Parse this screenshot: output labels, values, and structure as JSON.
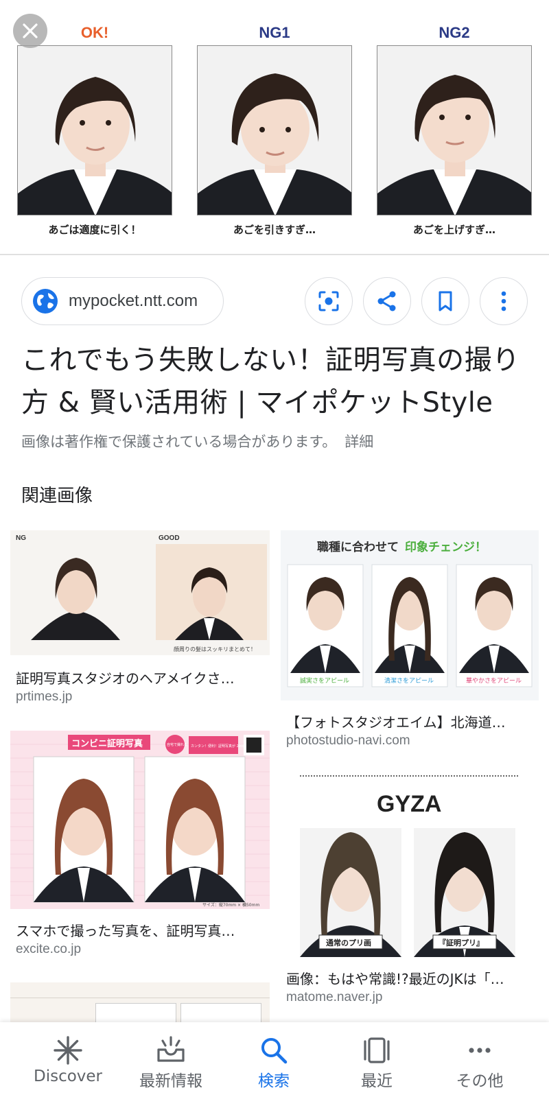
{
  "hero": {
    "panels": [
      {
        "label": "OK!",
        "caption": "あごは適度に引く！",
        "label_color": "#e8602c"
      },
      {
        "label": "NG1",
        "caption": "あごを引きすぎ…",
        "label_color": "#2b3a86"
      },
      {
        "label": "NG2",
        "caption": "あごを上げすぎ…",
        "label_color": "#2b3a86"
      }
    ]
  },
  "source": {
    "domain": "mypocket.ntt.com"
  },
  "result": {
    "title": "これでもう失敗しない！証明写真の撮り方 & 賢い活用術 | マイポケットStyle",
    "copyright_notice": "画像は著作権で保護されている場合があります。",
    "details_link": "詳細"
  },
  "related": {
    "header": "関連画像",
    "items": [
      {
        "title": "証明写真スタジオのヘアメイクさ…",
        "domain": "prtimes.jp",
        "labels": {
          "left": "NG",
          "right": "GOOD",
          "note": "顔周りの髪はスッキリまとめて！"
        }
      },
      {
        "title": "【フォトスタジオエイム】北海道…",
        "domain": "photostudio-navi.com",
        "labels": {
          "head_a": "職種に合わせて",
          "head_b": "印象チェンジ！",
          "cap1": "誠実さをアピール",
          "cap2": "清潔さをアピール",
          "cap3": "華やかさをアピール"
        }
      },
      {
        "title": "スマホで撮った写真を、証明写真…",
        "domain": "excite.co.jp",
        "labels": {
          "brand": "コンビニ証明写真",
          "promo": "カンタン！便利！証明写真が 200円",
          "badge": "自宅で撮れる",
          "size": "サイズ：縦70mm × 横50mm"
        }
      },
      {
        "title": "画像：もはや常識!?最近のJKは「…",
        "domain": "matome.naver.jp",
        "labels": {
          "logo": "GYZA",
          "cap1": "通常のプリ画",
          "cap2": "『証明プリ』"
        }
      }
    ]
  },
  "bottom_nav": {
    "items": [
      {
        "label": "Discover",
        "icon": "asterisk-icon"
      },
      {
        "label": "最新情報",
        "icon": "inbox-updates-icon"
      },
      {
        "label": "検索",
        "icon": "search-icon",
        "active": true
      },
      {
        "label": "最近",
        "icon": "recent-tabs-icon"
      },
      {
        "label": "その他",
        "icon": "more-horizontal-icon"
      }
    ]
  },
  "colors": {
    "accent": "#1a73e8",
    "text_secondary": "#70757a",
    "border": "#dadce0"
  }
}
